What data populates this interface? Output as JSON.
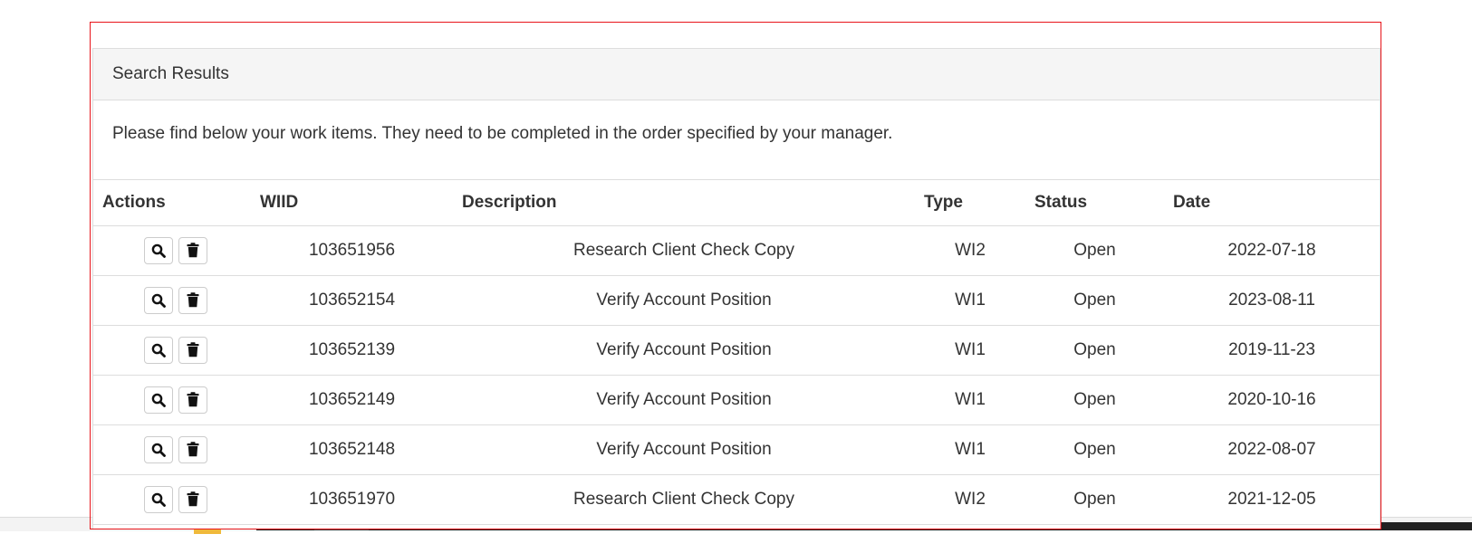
{
  "panel": {
    "heading": "Search Results",
    "intro": "Please find below your work items. They need to be completed in the order specified by your manager."
  },
  "table": {
    "columns": [
      "Actions",
      "WIID",
      "Description",
      "Type",
      "Status",
      "Date"
    ],
    "rows": [
      {
        "wiid": "103651956",
        "description": "Research Client Check Copy",
        "type": "WI2",
        "status": "Open",
        "date": "2022-07-18"
      },
      {
        "wiid": "103652154",
        "description": "Verify Account Position",
        "type": "WI1",
        "status": "Open",
        "date": "2023-08-11"
      },
      {
        "wiid": "103652139",
        "description": "Verify Account Position",
        "type": "WI1",
        "status": "Open",
        "date": "2019-11-23"
      },
      {
        "wiid": "103652149",
        "description": "Verify Account Position",
        "type": "WI1",
        "status": "Open",
        "date": "2020-10-16"
      },
      {
        "wiid": "103652148",
        "description": "Verify Account Position",
        "type": "WI1",
        "status": "Open",
        "date": "2022-08-07"
      },
      {
        "wiid": "103651970",
        "description": "Research Client Check Copy",
        "type": "WI2",
        "status": "Open",
        "date": "2021-12-05"
      }
    ]
  },
  "icons": {
    "view": "search-icon",
    "delete": "trash-icon"
  },
  "colors": {
    "highlight_border": "#e8141a",
    "heading_bg": "#f5f5f5",
    "text": "#333333"
  }
}
